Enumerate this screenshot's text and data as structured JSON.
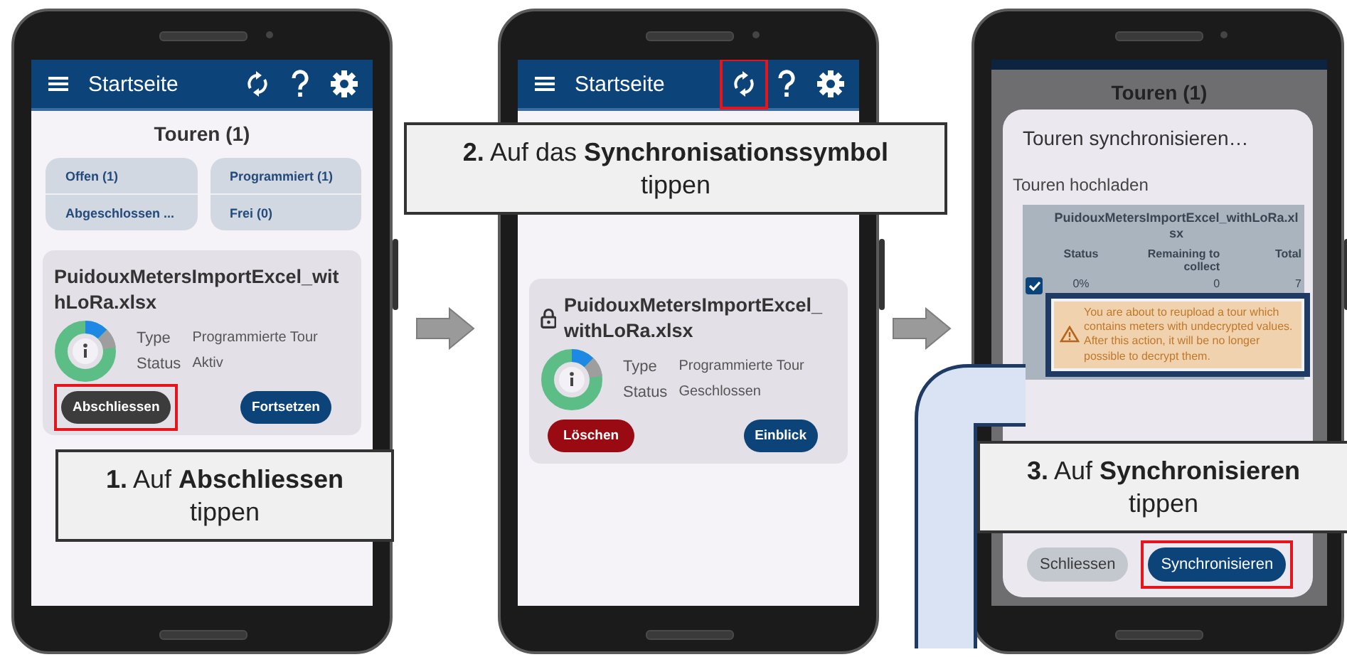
{
  "steps": [
    {
      "screen": {
        "kind": "home",
        "app_bar": {
          "title": "Startseite",
          "sync_highlighted": false
        },
        "heading": "Touren (1)",
        "filters": [
          {
            "label": "Offen (1)"
          },
          {
            "label": "Programmiert (1)"
          },
          {
            "label": "Abgeschlossen ..."
          },
          {
            "label": "Frei (0)"
          }
        ],
        "tour": {
          "name": "PuidouxMetersImportExcel_withLoRa.xlsx",
          "locked": false,
          "type_label": "Type",
          "type_value": "Programmierte Tour",
          "status_label": "Status",
          "status_value": "Aktiv",
          "actions": [
            {
              "label": "Abschliessen",
              "kind": "dark",
              "highlighted": true
            },
            {
              "label": "Fortsetzen",
              "kind": "primary",
              "highlighted": false
            }
          ]
        }
      },
      "callout": "**1.** Auf **Abschliessen**\ntippen"
    },
    {
      "screen": {
        "kind": "home",
        "app_bar": {
          "title": "Startseite",
          "sync_highlighted": true
        },
        "tour": {
          "name": "PuidouxMetersImportExcel_withLoRa.xlsx",
          "locked": true,
          "type_label": "Type",
          "type_value": "Programmierte Tour",
          "status_label": "Status",
          "status_value": "Geschlossen",
          "actions": [
            {
              "label": "Löschen",
              "kind": "danger",
              "highlighted": false
            },
            {
              "label": "Einblick",
              "kind": "primary",
              "highlighted": false
            }
          ]
        }
      },
      "callout": "**2.** Auf das **Synchronisationssymbol**\ntippen"
    },
    {
      "screen": {
        "kind": "sync_dialog",
        "background_heading": "Touren (1)",
        "dialog": {
          "title": "Touren synchronisieren…",
          "section": "Touren hochladen",
          "table": {
            "title": "PuidouxMetersImportExcel_withLoRa.xlsx",
            "columns": [
              "Status",
              "Remaining to collect",
              "Total"
            ],
            "rows": [
              {
                "checked": true,
                "cells": [
                  "0%",
                  "0",
                  "7"
                ]
              }
            ]
          },
          "warning": "You are about to reupload a tour which contains meters with undecrypted values. After this action, it will be no longer possible to decrypt them.",
          "buttons": [
            {
              "label": "Schliessen",
              "kind": "secondary",
              "highlighted": false
            },
            {
              "label": "Synchronisieren",
              "kind": "primary",
              "highlighted": true
            }
          ]
        }
      },
      "callout": "**3.** Auf **Synchronisieren**\ntippen"
    }
  ]
}
